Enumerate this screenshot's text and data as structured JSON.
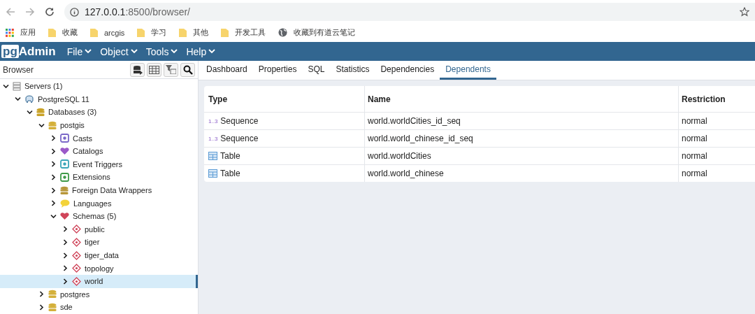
{
  "address_bar": {
    "url_host": "127.0.0.1",
    "url_rest": ":8500/browser/"
  },
  "bookmarks": [
    {
      "kind": "apps",
      "label": "应用"
    },
    {
      "kind": "folder",
      "label": "收藏"
    },
    {
      "kind": "folder",
      "label": "arcgis"
    },
    {
      "kind": "folder",
      "label": "学习"
    },
    {
      "kind": "folder",
      "label": "其他"
    },
    {
      "kind": "folder",
      "label": "开发工具"
    },
    {
      "kind": "globe",
      "label": "收藏到有道云笔记"
    }
  ],
  "app": {
    "logo_box": "pg",
    "logo_text": "Admin",
    "menus": [
      "File",
      "Object",
      "Tools",
      "Help"
    ]
  },
  "browser_panel": {
    "title": "Browser"
  },
  "tree": [
    {
      "kind": "servers",
      "label": "Servers (1)",
      "expanded": true,
      "selected": false,
      "children": [
        {
          "kind": "server",
          "label": "PostgreSQL 11",
          "expanded": true,
          "selected": false,
          "children": [
            {
              "kind": "database-group",
              "label": "Databases (3)",
              "expanded": true,
              "selected": false,
              "children": [
                {
                  "kind": "database",
                  "label": "postgis",
                  "expanded": true,
                  "selected": false,
                  "children": [
                    {
                      "kind": "casts",
                      "label": "Casts",
                      "expanded": false,
                      "selected": false
                    },
                    {
                      "kind": "catalogs",
                      "label": "Catalogs",
                      "expanded": false,
                      "selected": false
                    },
                    {
                      "kind": "event-triggers",
                      "label": "Event Triggers",
                      "expanded": false,
                      "selected": false
                    },
                    {
                      "kind": "extensions",
                      "label": "Extensions",
                      "expanded": false,
                      "selected": false
                    },
                    {
                      "kind": "fdw",
                      "label": "Foreign Data Wrappers",
                      "expanded": false,
                      "selected": false
                    },
                    {
                      "kind": "languages",
                      "label": "Languages",
                      "expanded": false,
                      "selected": false
                    },
                    {
                      "kind": "schemas",
                      "label": "Schemas (5)",
                      "expanded": true,
                      "selected": false,
                      "children": [
                        {
                          "kind": "schema",
                          "label": "public",
                          "expanded": false,
                          "selected": false
                        },
                        {
                          "kind": "schema",
                          "label": "tiger",
                          "expanded": false,
                          "selected": false
                        },
                        {
                          "kind": "schema",
                          "label": "tiger_data",
                          "expanded": false,
                          "selected": false
                        },
                        {
                          "kind": "schema",
                          "label": "topology",
                          "expanded": false,
                          "selected": false
                        },
                        {
                          "kind": "schema",
                          "label": "world",
                          "expanded": false,
                          "selected": true
                        }
                      ]
                    }
                  ]
                },
                {
                  "kind": "database",
                  "label": "postgres",
                  "expanded": false,
                  "selected": false
                },
                {
                  "kind": "database",
                  "label": "sde",
                  "expanded": false,
                  "selected": false
                }
              ]
            }
          ]
        }
      ]
    }
  ],
  "tabs": [
    {
      "label": "Dashboard",
      "selected": false
    },
    {
      "label": "Properties",
      "selected": false
    },
    {
      "label": "SQL",
      "selected": false
    },
    {
      "label": "Statistics",
      "selected": false
    },
    {
      "label": "Dependencies",
      "selected": false
    },
    {
      "label": "Dependents",
      "selected": true
    }
  ],
  "table": {
    "columns": [
      "Type",
      "Name",
      "Restriction"
    ],
    "rows": [
      {
        "kind": "sequence",
        "type_icon_text": "1..3",
        "type": "Sequence",
        "name": "world.worldCities_id_seq",
        "restriction": "normal"
      },
      {
        "kind": "sequence",
        "type_icon_text": "1..3",
        "type": "Sequence",
        "name": "world.world_chinese_id_seq",
        "restriction": "normal"
      },
      {
        "kind": "table",
        "type": "Table",
        "name": "world.worldCities",
        "restriction": "normal"
      },
      {
        "kind": "table",
        "type": "Table",
        "name": "world.world_chinese",
        "restriction": "normal"
      }
    ]
  }
}
